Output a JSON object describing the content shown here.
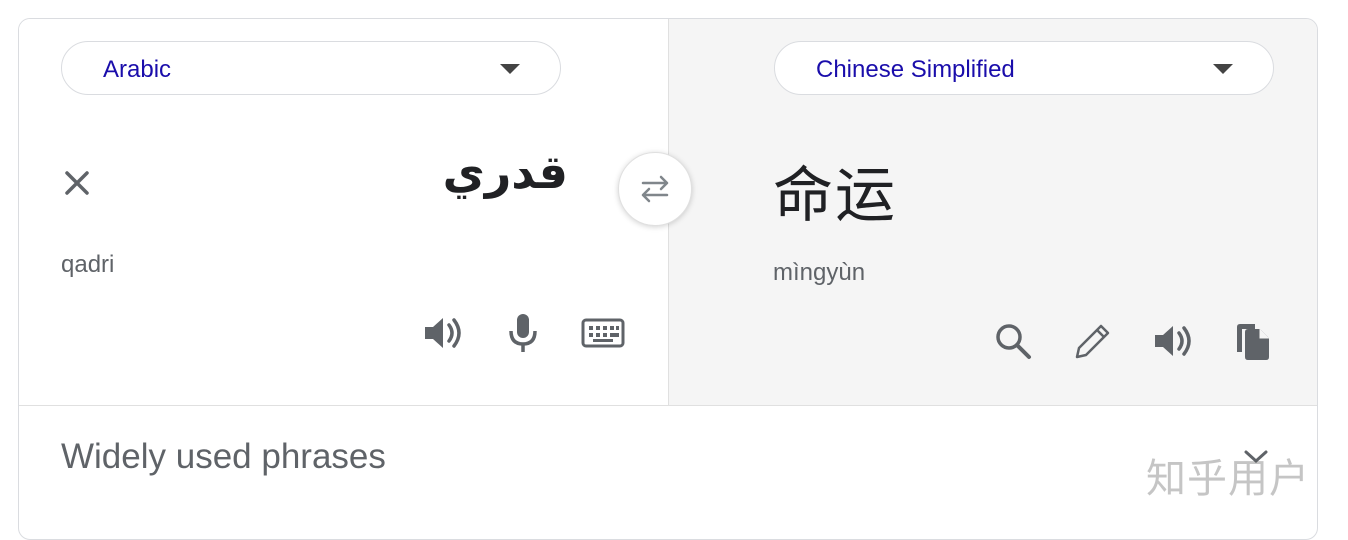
{
  "source": {
    "language": "Arabic",
    "text": "قدري",
    "transliteration": "qadri",
    "icons": [
      "close-icon",
      "speaker-icon",
      "microphone-icon",
      "keyboard-icon"
    ]
  },
  "target": {
    "language": "Chinese Simplified",
    "text": "命运",
    "transliteration": "mìngyùn",
    "icons": [
      "search-icon",
      "pencil-icon",
      "speaker-icon",
      "copy-icon"
    ]
  },
  "swap": {
    "icon": "swap-arrows-icon"
  },
  "phrases": {
    "title": "Widely used phrases",
    "icon": "chevron-down-icon"
  },
  "watermark": {
    "text": "知乎用户"
  },
  "colors": {
    "link": "#1a0dab",
    "icon": "#5f6368",
    "pane_right": "#f5f5f5",
    "border": "#dadce0"
  }
}
